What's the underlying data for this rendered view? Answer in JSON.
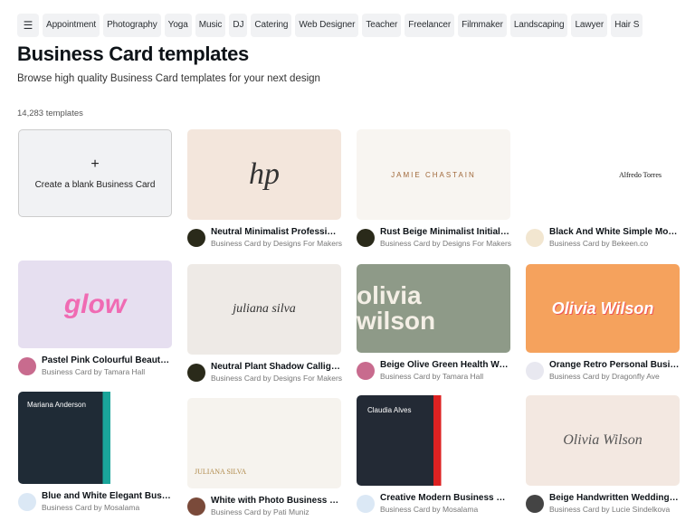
{
  "filters": [
    "Appointment",
    "Photography",
    "Yoga",
    "Music",
    "DJ",
    "Catering",
    "Web Designer",
    "Teacher",
    "Freelancer",
    "Filmmaker",
    "Landscaping",
    "Lawyer",
    "Hair S"
  ],
  "title": "Business Card templates",
  "subtitle": "Browse high quality Business Card templates for your next design",
  "count": "14,283 templates",
  "blank": {
    "plus": "+",
    "label": "Create a blank Business Card"
  },
  "cards": [
    {
      "title": "Neutral Minimalist Profession...",
      "by": "Business Card by Designs For Makers",
      "thumb": "hp",
      "bg": "#f3e6dc"
    },
    {
      "title": "Rust Beige Minimalist Initial Si...",
      "by": "Business Card by Designs For Makers",
      "thumb": "JAMIE CHASTAIN",
      "bg": "#f8f5f1"
    },
    {
      "title": "Black And White Simple Moder...",
      "by": "Business Card by Bekeen.co",
      "thumb": "Alfredo Torres",
      "bg": "#ffffff"
    },
    {
      "title": "Pastel Pink Colourful Beauty B...",
      "by": "Business Card by Tamara Hall",
      "thumb": "glow",
      "bg": "#e6dff0"
    },
    {
      "title": "Neutral Plant Shadow Calligra...",
      "by": "Business Card by Designs For Makers",
      "thumb": "juliana silva",
      "bg": "#eeeae6"
    },
    {
      "title": "Beige Olive Green Health Well...",
      "by": "Business Card by Tamara Hall",
      "thumb": "olivia wilson",
      "bg": "#8e9a88"
    },
    {
      "title": "Orange Retro Personal Busine...",
      "by": "Business Card by Dragonfly Ave",
      "thumb": "Olivia Wilson",
      "bg": "#f5a25d"
    },
    {
      "title": "Blue and White Elegant Busine...",
      "by": "Business Card by Mosalama",
      "thumb": "Mariana Anderson",
      "bg": "#1f2b36"
    },
    {
      "title": "White with Photo Business Car...",
      "by": "Business Card by Pati Muniz",
      "thumb": "JULIANA SILVA",
      "bg": "#f6f3ee"
    },
    {
      "title": "Creative Modern Business Card",
      "by": "Business Card by Mosalama",
      "thumb": "Claudia Alves",
      "bg": "#232a35"
    },
    {
      "title": "Beige Handwritten Wedding A...",
      "by": "Business Card by Lucie Sindelkova",
      "thumb": "Olivia Wilson",
      "bg": "#f3e8e1"
    }
  ]
}
